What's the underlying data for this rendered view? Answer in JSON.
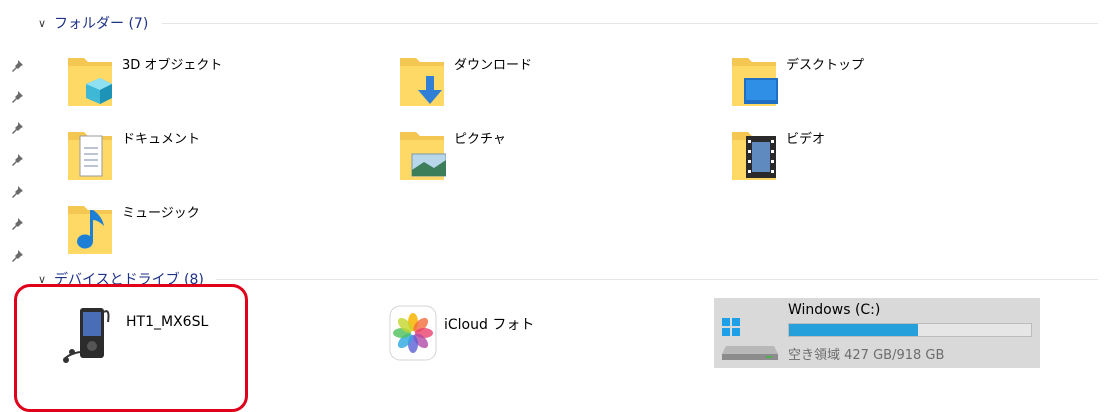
{
  "groups": {
    "folders": {
      "title": "フォルダー (7)"
    },
    "devices": {
      "title": "デバイスとドライブ (8)"
    }
  },
  "folders": [
    {
      "label": "3D オブジェクト",
      "icon": "3d-objects-folder-icon"
    },
    {
      "label": "ダウンロード",
      "icon": "downloads-folder-icon"
    },
    {
      "label": "デスクトップ",
      "icon": "desktop-folder-icon"
    },
    {
      "label": "ドキュメント",
      "icon": "documents-folder-icon"
    },
    {
      "label": "ピクチャ",
      "icon": "pictures-folder-icon"
    },
    {
      "label": "ビデオ",
      "icon": "videos-folder-icon"
    },
    {
      "label": "ミュージック",
      "icon": "music-folder-icon"
    }
  ],
  "devices": [
    {
      "label": "HT1_MX6SL",
      "icon": "media-player-device-icon"
    },
    {
      "label": "iCloud フォト",
      "icon": "icloud-photos-icon"
    },
    {
      "label": "Windows (C:)",
      "icon": "windows-drive-icon",
      "free_text": "空き領域 427 GB/918 GB",
      "used_fraction": 0.535
    }
  ],
  "colors": {
    "header": "#1e3287",
    "highlight": "#e0001a",
    "drive_bar": "#26a0da",
    "selected_bg": "#d9d9d9"
  }
}
